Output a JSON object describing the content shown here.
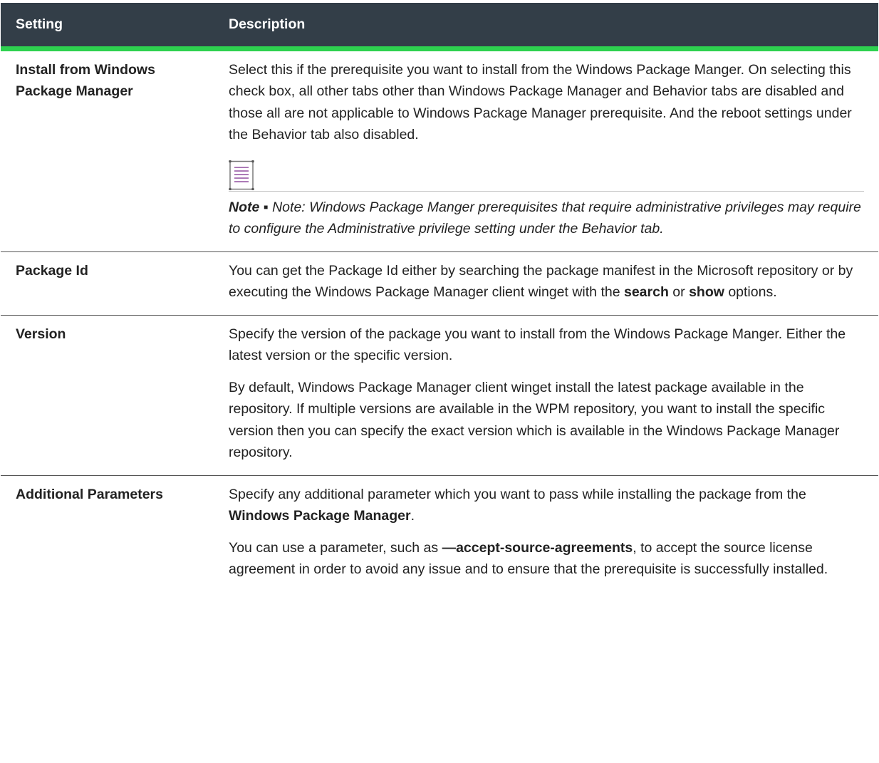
{
  "table": {
    "headers": {
      "setting": "Setting",
      "description": "Description"
    },
    "rows": [
      {
        "setting": "Install from Windows Package Manager",
        "desc_p1": "Select this if the prerequisite you want to install from the Windows Package Manger. On selecting this check box, all other tabs other than Windows Package Manager and Behavior tabs are disabled and those all are not applicable to Windows Package Manager prerequisite. And the reboot settings under the Behavior tab also disabled.",
        "note_icon": "note-document-icon",
        "note_label": "Note",
        "note_separator": " ▪ ",
        "note_text": "Note: Windows Package Manger prerequisites that require administrative privileges may require to configure the Administrative privilege setting under the Behavior tab."
      },
      {
        "setting": "Package Id",
        "desc_p1_a": "You can get the Package Id either by searching the package manifest in the Microsoft repository or by executing the Windows Package Manager client winget with the ",
        "desc_p1_kw1": "search",
        "desc_p1_b": " or ",
        "desc_p1_kw2": "show",
        "desc_p1_c": " options."
      },
      {
        "setting": "Version",
        "desc_p1": "Specify the version of the package you want to install from the Windows Package Manger. Either the latest version or the specific version.",
        "desc_p2": "By default, Windows Package Manager client winget install the latest package available in the repository. If multiple versions are available in the WPM repository, you want to install the specific version then you can specify the exact version which is available in the Windows Package Manager repository."
      },
      {
        "setting": "Additional Parameters",
        "desc_p1_a": "Specify any additional parameter which you want to pass while installing the package from the ",
        "desc_p1_kw": "Windows Package Manager",
        "desc_p1_b": ".",
        "desc_p2_a": "You can use a parameter, such as ",
        "desc_p2_kw": "—accept-source-agreements",
        "desc_p2_b": ", to accept the source license agreement in order to avoid any issue and to ensure that the prerequisite is successfully installed."
      }
    ]
  },
  "colors": {
    "header_bg": "#333e48",
    "header_accent": "#2ed14f",
    "note_icon": "#7a2b8c"
  }
}
